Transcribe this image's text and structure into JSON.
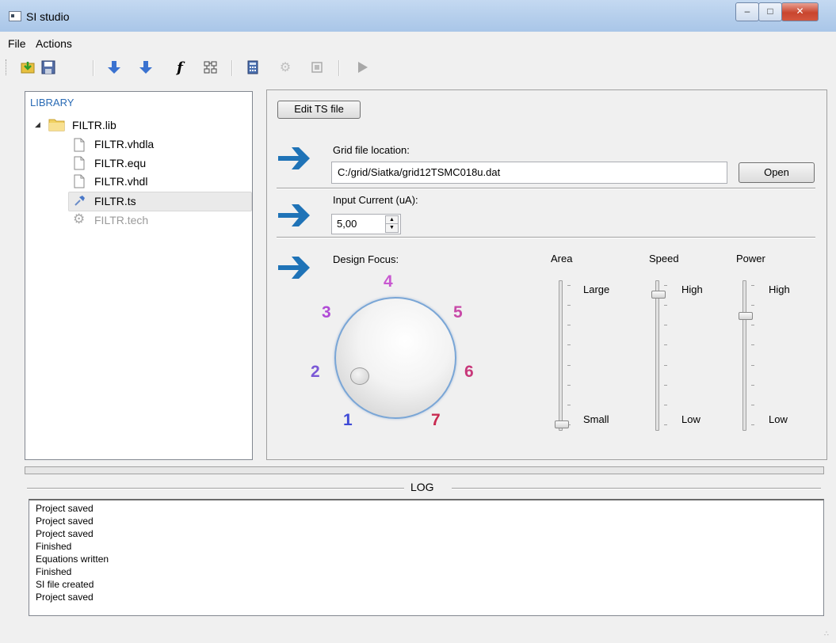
{
  "window": {
    "title": "SI studio"
  },
  "menu": [
    "File",
    "Actions"
  ],
  "toolbar": [
    "import-icon",
    "save-icon",
    "arrow-down-icon",
    "arrow-down-icon",
    "function-icon",
    "hierarchy-icon",
    "calculator-icon",
    "gear-icon",
    "chip-icon",
    "play-icon"
  ],
  "library": {
    "title": "LIBRARY",
    "root": "FILTR.lib",
    "items": [
      "FILTR.vhdla",
      "FILTR.equ",
      "FILTR.vhdl",
      "FILTR.ts",
      "FILTR.tech"
    ],
    "selected": "FILTR.ts"
  },
  "panel": {
    "edit_button": "Edit TS file",
    "grid_label": "Grid file location:",
    "grid_value": "C:/grid/Siatka/grid12TSMC018u.dat",
    "open_button": "Open",
    "current_label": "Input Current (uA):",
    "current_value": "5,00",
    "focus_label": "Design Focus:",
    "dial_numbers": [
      "1",
      "2",
      "3",
      "4",
      "5",
      "6",
      "7"
    ],
    "dial_value": 2,
    "sliders": {
      "area": {
        "title": "Area",
        "top": "Large",
        "bottom": "Small",
        "level": 0.0
      },
      "speed": {
        "title": "Speed",
        "top": "High",
        "bottom": "Low",
        "level": 0.93
      },
      "power": {
        "title": "Power",
        "top": "High",
        "bottom": "Low",
        "level": 0.78
      }
    }
  },
  "log": {
    "title": "LOG",
    "lines": [
      "Project saved",
      "Project saved",
      "Project saved",
      "Finished",
      "Equations written",
      "Finished",
      "SI file created",
      "Project saved"
    ]
  }
}
